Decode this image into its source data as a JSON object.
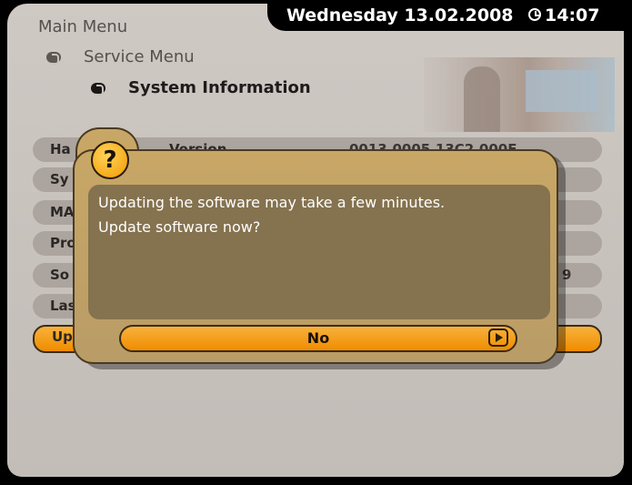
{
  "header": {
    "date": "Wednesday 13.02.2008",
    "time": "14:07"
  },
  "breadcrumb": [
    "Main Menu",
    "Service Menu",
    "System Information"
  ],
  "rows": [
    {
      "label": "Ha",
      "value": "0013.0005.13C2.000F"
    },
    {
      "label": "Sy",
      "value": ""
    },
    {
      "label": "MA",
      "value": ""
    },
    {
      "label": "Pro",
      "value": ""
    },
    {
      "label": "So",
      "value": "9"
    },
    {
      "label": "Las",
      "value": ""
    },
    {
      "label": "Up",
      "value": ""
    }
  ],
  "row0_partial": "Version",
  "dialog": {
    "icon": "?",
    "line1": "Updating the software may take a few minutes.",
    "line2": "Update software now?",
    "button": "No"
  },
  "colors": {
    "accent": "#f29a00",
    "panel": "#c8c2bd",
    "dialog": "#b99c66"
  }
}
